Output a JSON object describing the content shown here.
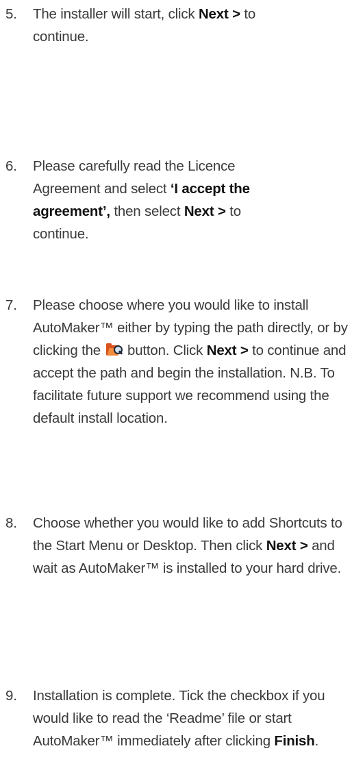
{
  "steps": [
    {
      "number": "5.",
      "t1": "The installer will start, click ",
      "b1": "Next >",
      "t2": " to continue."
    },
    {
      "number": "6.",
      "t1": "Please carefully read the Licence Agreement and select ",
      "b1": "‘I accept the agreement’,",
      "t2": " then select ",
      "b2": "Next >",
      "t3": " to continue."
    },
    {
      "number": "7.",
      "t1": "Please choose where you would like to install AutoMaker™ either by typing the path directly, or by clicking the ",
      "icon": "folder-search-icon",
      "t2": " button. Click ",
      "b1": "Next >",
      "t3": " to continue and accept the path and begin the installation. N.B. To facilitate future support we recommend using the default install location."
    },
    {
      "number": "8.",
      "t1": "Choose whether you would like to add Shortcuts to the Start Menu or Desktop. Then click ",
      "b1": "Next >",
      "t2": " and wait as AutoMaker™ is installed to your hard drive."
    },
    {
      "number": "9.",
      "t1": "Installation is complete. Tick the checkbox if you would like to read the ‘Readme’ file or start AutoMaker™ immediately after clicking ",
      "b1": "Finish",
      "t2": "."
    }
  ]
}
